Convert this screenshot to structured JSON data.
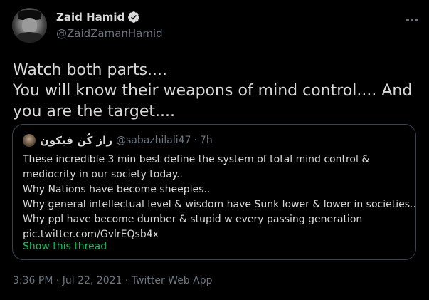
{
  "author": {
    "display_name": "Zaid Hamid",
    "handle": "@ZaidZamanHamid"
  },
  "tweet": {
    "text": "Watch both parts....\nYou will know their weapons of mind control.... And you are the target...."
  },
  "quote": {
    "name": "راز کُن فیکون",
    "handle": "@sabazhilali47",
    "separator": "·",
    "time": "7h",
    "lines": [
      "These incredible 3 min best define the system of total mind control & mediocrity in our society today..",
      "Why Nations have become sheeples..",
      "Why general intellectual level & wisdom have Sunk lower & lower in societies..",
      "Why ppl have become dumber & stupid w every passing generation",
      "pic.twitter.com/GvlrEQsb4x"
    ],
    "show_thread": "Show this thread"
  },
  "meta": {
    "timestamp": "3:36 PM · Jul 22, 2021 · Twitter Web App"
  },
  "colors": {
    "background": "#000000",
    "text": "#d9d9d9",
    "secondary": "#6e767d",
    "border": "#38444d",
    "link": "#17bf63"
  },
  "icons": [
    "verified-badge-icon",
    "more-options-icon"
  ]
}
